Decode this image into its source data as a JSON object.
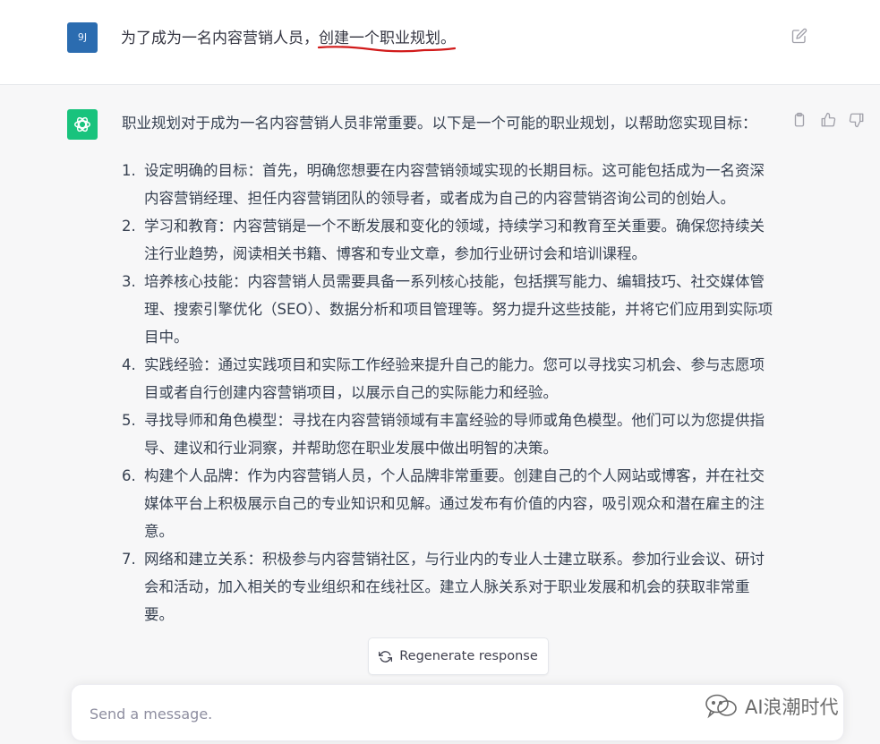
{
  "user_message": {
    "avatar_text": "9J",
    "text_plain": "为了成为一名内容营销人员，",
    "text_highlighted": "创建一个职业规划。",
    "highlight_color": "#d11a1a"
  },
  "assistant_message": {
    "intro": "职业规划对于成为一名内容营销人员非常重要。以下是一个可能的职业规划，以帮助您实现目标：",
    "items": [
      {
        "num": "1.",
        "text": "设定明确的目标：首先，明确您想要在内容营销领域实现的长期目标。这可能包括成为一名资深内容营销经理、担任内容营销团队的领导者，或者成为自己的内容营销咨询公司的创始人。"
      },
      {
        "num": "2.",
        "text": "学习和教育：内容营销是一个不断发展和变化的领域，持续学习和教育至关重要。确保您持续关注行业趋势，阅读相关书籍、博客和专业文章，参加行业研讨会和培训课程。"
      },
      {
        "num": "3.",
        "text": "培养核心技能：内容营销人员需要具备一系列核心技能，包括撰写能力、编辑技巧、社交媒体管理、搜索引擎优化（SEO）、数据分析和项目管理等。努力提升这些技能，并将它们应用到实际项目中。"
      },
      {
        "num": "4.",
        "text": "实践经验：通过实践项目和实际工作经验来提升自己的能力。您可以寻找实习机会、参与志愿项目或者自行创建内容营销项目，以展示自己的实际能力和经验。"
      },
      {
        "num": "5.",
        "text": "寻找导师和角色模型：寻找在内容营销领域有丰富经验的导师或角色模型。他们可以为您提供指导、建议和行业洞察，并帮助您在职业发展中做出明智的决策。"
      },
      {
        "num": "6.",
        "text": "构建个人品牌：作为内容营销人员，个人品牌非常重要。创建自己的个人网站或博客，并在社交媒体平台上积极展示自己的专业知识和见解。通过发布有价值的内容，吸引观众和潜在雇主的注意。"
      },
      {
        "num": "7.",
        "text": "网络和建立关系：积极参与内容营销社区，与行业内的专业人士建立联系。参加行业会议、研讨会和活动，加入相关的专业组织和在线社区。建立人脉关系对于职业发展和机会的获取非常重要。"
      }
    ]
  },
  "regenerate_label": "Regenerate response",
  "composer": {
    "placeholder": "Send a message."
  },
  "watermark": {
    "text": "AI浪潮时代",
    "icon": "wechat-icon"
  },
  "colors": {
    "assistant_bg": "#f7f7f8",
    "gpt_green": "#19c37d",
    "user_avatar": "#2b6cb0"
  }
}
